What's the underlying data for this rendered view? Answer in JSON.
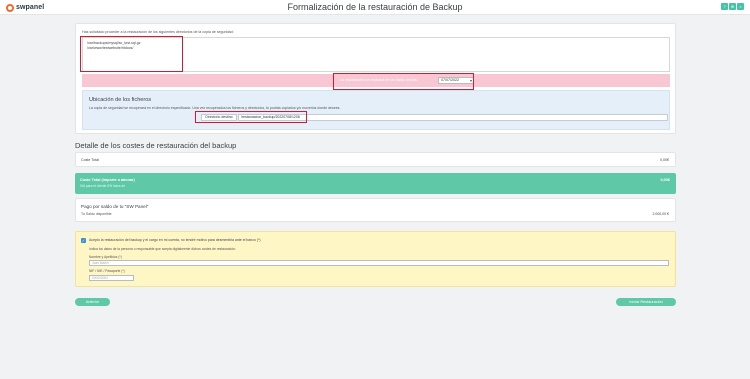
{
  "header": {
    "logo_text": "swpanel",
    "title": "Formalización de la restauración de Backup",
    "window_buttons": [
      "?",
      "⊕",
      "×"
    ]
  },
  "restore": {
    "intro": "Has solicitado proceder a la restauración de los siguientes directorios de la copia de seguridad:",
    "directories": [
      "/var/backups/mysql/sc_test.sql.gz",
      "/var/www/testwebsite/htdocs/"
    ],
    "date_label": "La restauración se realizará de los datos del día:",
    "date_value": "07/07/2022"
  },
  "location": {
    "title": "Ubicación de los ficheros",
    "description": "La copia de seguridad se recuperará en el directorio especificado. Una vez recuperados los ficheros y directorios, tú podrás copiarlos y/o moverlos donde desees.",
    "dest_label": "Directorio destino",
    "dest_value": "/restauracion_backup/20220708/1206"
  },
  "costs": {
    "section_title": "Detalle de los costes de restauración del backup",
    "coste_total_label": "Coste Total",
    "coste_total_value": "0,00€",
    "importe_label": "Coste Total (importe a abonar)",
    "importe_sub": "IVA para el cliente 0% fuera de",
    "importe_value": "0,00€",
    "pay_title": "Pago por saldo de tu \"SW Panel\"",
    "pay_sub": "Tu Saldo disponible",
    "pay_value": "2.000,00 €"
  },
  "acceptance": {
    "checkbox_text": "Acepto la restauración del backup y el cargo en mi cuenta, no tendré motivo para desmentirla ante el banco (*)",
    "indication": "Indica los datos de la persona o responsable que acepta digitalmente dichos costes de restauración:",
    "name_label": "Nombre y Apellidos (*)",
    "name_placeholder": "Juan Martín",
    "nif_label": "NIF / NIE / Pasaporte (*)",
    "nif_placeholder": "00000000X"
  },
  "buttons": {
    "prev": "Anterior",
    "start": "Iniciar Restauración"
  },
  "colors": {
    "accent": "#5ec8a7",
    "highlight": "#d7192f",
    "warning_bg": "#fff6c6",
    "date_bg": "#f8c7d3"
  }
}
